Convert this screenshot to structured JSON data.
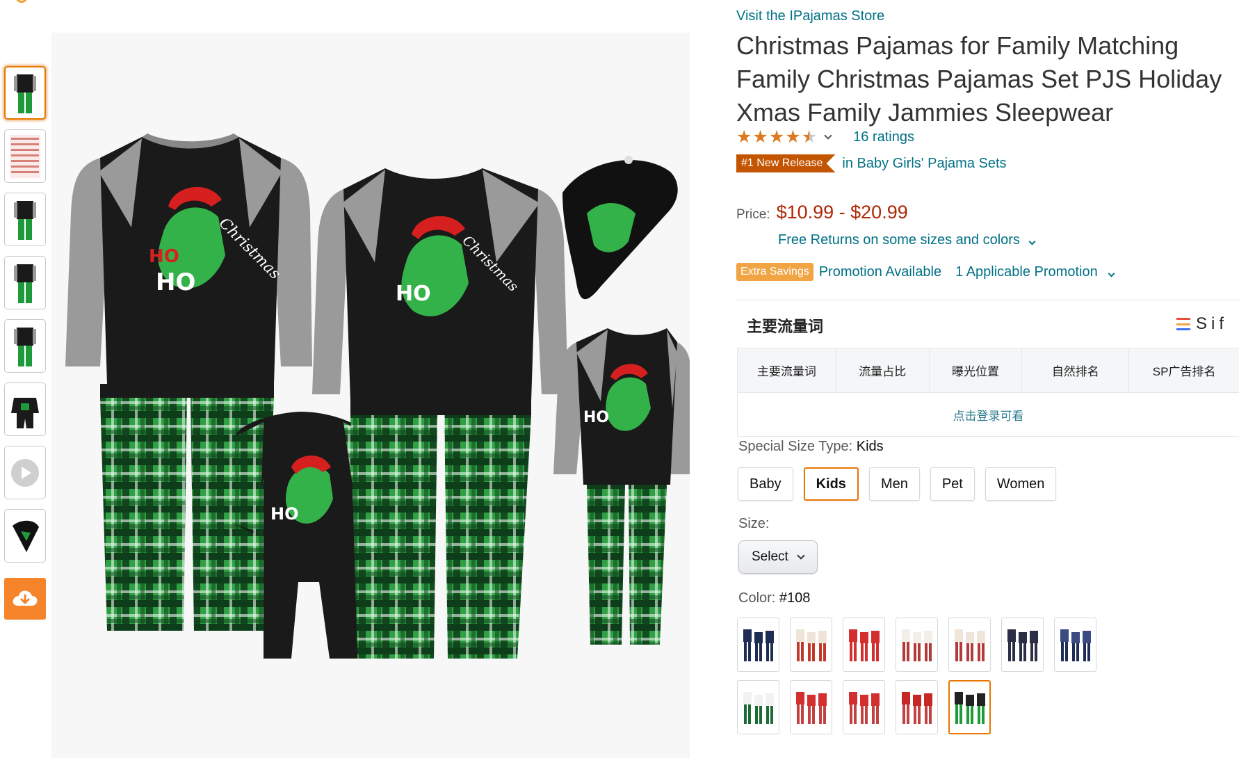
{
  "thumbnails": [
    {
      "name": "family-green-plaid",
      "accent": "#1f9a3a"
    },
    {
      "name": "size-chart",
      "accent": "#c0392b"
    },
    {
      "name": "adult-front",
      "accent": "#1f9a3a"
    },
    {
      "name": "adult-side",
      "accent": "#1f9a3a"
    },
    {
      "name": "adult-back",
      "accent": "#1f9a3a"
    },
    {
      "name": "baby-romper",
      "accent": "#1f9a3a"
    },
    {
      "name": "video",
      "accent": "#888888"
    },
    {
      "name": "pet-bandana",
      "accent": "#1f9a3a"
    }
  ],
  "store_link": "Visit the IPajamas Store",
  "title": "Christmas Pajamas for Family Matching Family Christmas Pajamas Set PJS Holiday Xmas Family Jammies Sleepwear",
  "rating": {
    "stars": 4.5,
    "count_text": "16 ratings"
  },
  "badge": {
    "label": "#1 New Release",
    "category": "in Baby Girls' Pajama Sets"
  },
  "price": {
    "label": "Price:",
    "value": "$10.99 - $20.99"
  },
  "returns": "Free Returns on some sizes and colors",
  "promo": {
    "badge": "Extra Savings",
    "available": "Promotion Available",
    "link": "1 Applicable Promotion"
  },
  "keyword_widget": {
    "title": "主要流量词",
    "brand": "Sif",
    "columns": [
      "主要流量词",
      "流量占比",
      "曝光位置",
      "自然排名",
      "SP广告排名"
    ],
    "login_prompt": "点击登录可看"
  },
  "special_size": {
    "label": "Special Size Type:",
    "selected": "Kids",
    "options": [
      "Baby",
      "Kids",
      "Men",
      "Pet",
      "Women"
    ]
  },
  "size": {
    "label": "Size:",
    "select_value": "Select"
  },
  "color": {
    "label": "Color:",
    "selected": "#108",
    "swatches": [
      {
        "top": "#1f2d55",
        "bottom": "#1f2d55"
      },
      {
        "top": "#f0e4d8",
        "bottom": "#c0392b"
      },
      {
        "top": "#d32f2f",
        "bottom": "#d32f2f"
      },
      {
        "top": "#f3eee8",
        "bottom": "#b23a3a"
      },
      {
        "top": "#efe5da",
        "bottom": "#b23a3a"
      },
      {
        "top": "#2a2f45",
        "bottom": "#2a2f45"
      },
      {
        "top": "#3b4a80",
        "bottom": "#1f2d55"
      },
      {
        "top": "#f2f2f2",
        "bottom": "#1d6b34"
      },
      {
        "top": "#d32f2f",
        "bottom": "#c24141"
      },
      {
        "top": "#d32f2f",
        "bottom": "#c24141"
      },
      {
        "top": "#c62828",
        "bottom": "#c24141"
      },
      {
        "top": "#222222",
        "bottom": "#1f9a3a"
      }
    ]
  }
}
